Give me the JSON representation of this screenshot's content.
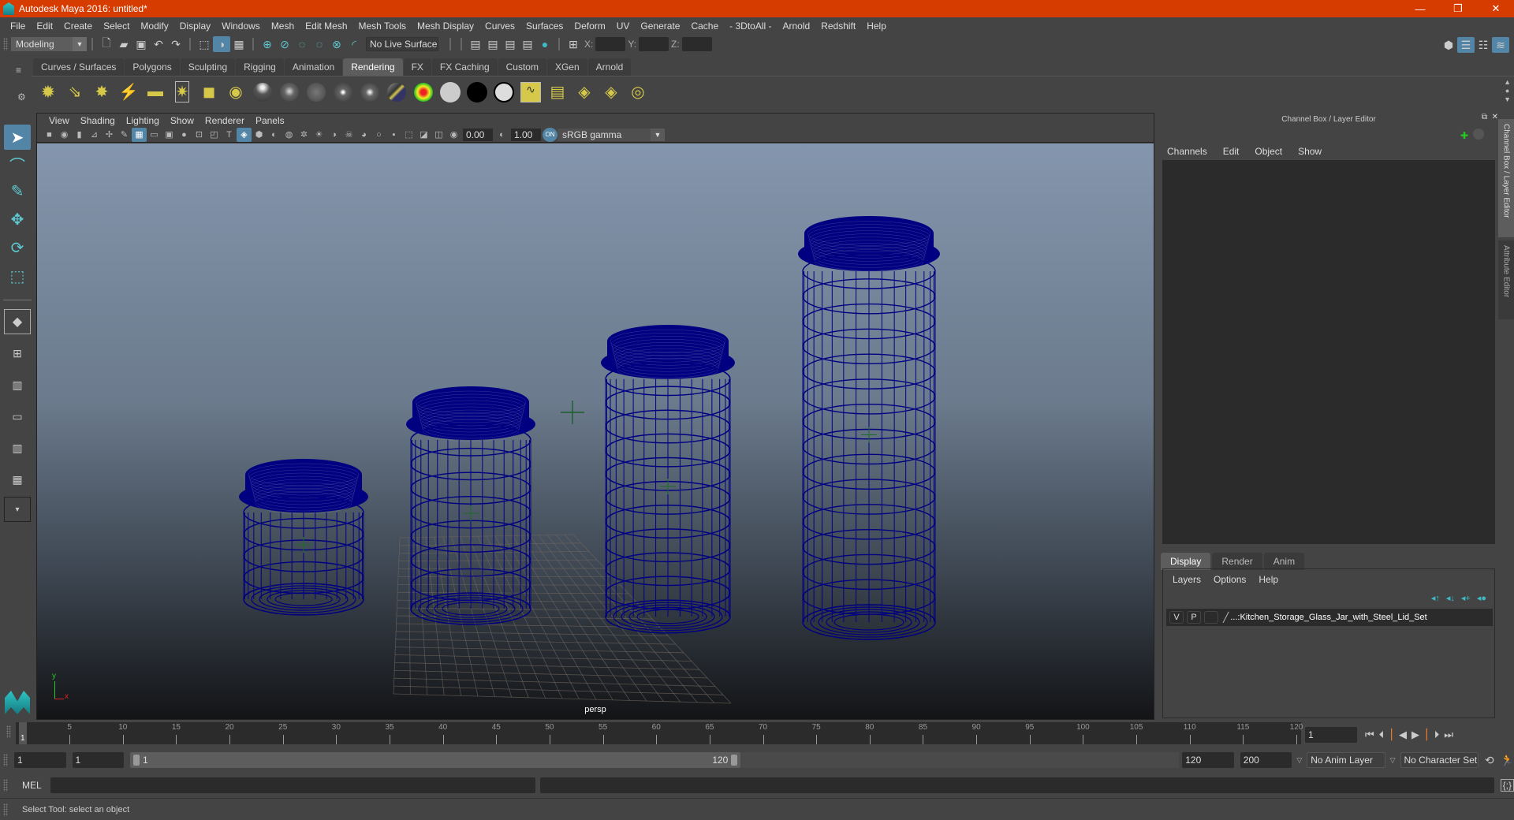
{
  "titlebar": {
    "title": "Autodesk Maya 2016: untitled*",
    "minimize": "—",
    "restore": "❐",
    "close": "✕"
  },
  "menubar": [
    "File",
    "Edit",
    "Create",
    "Select",
    "Modify",
    "Display",
    "Windows",
    "Mesh",
    "Edit Mesh",
    "Mesh Tools",
    "Mesh Display",
    "Curves",
    "Surfaces",
    "Deform",
    "UV",
    "Generate",
    "Cache",
    "- 3DtoAll -",
    "Arnold",
    "Redshift",
    "Help"
  ],
  "statusline": {
    "menuset": "Modeling",
    "live_surface": "No Live Surface",
    "x_label": "X:",
    "y_label": "Y:",
    "z_label": "Z:",
    "x_value": "",
    "y_value": "",
    "z_value": ""
  },
  "shelf": {
    "tabs": [
      "Curves / Surfaces",
      "Polygons",
      "Sculpting",
      "Rigging",
      "Animation",
      "Rendering",
      "FX",
      "FX Caching",
      "Custom",
      "XGen",
      "Arnold"
    ],
    "active_tab": "Rendering"
  },
  "viewport": {
    "menu": [
      "View",
      "Shading",
      "Lighting",
      "Show",
      "Renderer",
      "Panels"
    ],
    "exposure": "0.00",
    "gamma": "1.00",
    "color_space": "sRGB gamma",
    "camera_label": "persp",
    "axis_y": "y",
    "axis_x": "x"
  },
  "channel_box": {
    "title": "Channel Box / Layer Editor",
    "menu": [
      "Channels",
      "Edit",
      "Object",
      "Show"
    ]
  },
  "layer_editor": {
    "tabs": [
      "Display",
      "Render",
      "Anim"
    ],
    "active_tab": "Display",
    "menu": [
      "Layers",
      "Options",
      "Help"
    ],
    "layers": [
      {
        "v": "V",
        "p": "P",
        "name": "...:Kitchen_Storage_Glass_Jar_with_Steel_Lid_Set"
      }
    ]
  },
  "side_tabs": [
    "Channel Box / Layer Editor",
    "Attribute Editor"
  ],
  "timeline": {
    "ticks": [
      5,
      10,
      15,
      20,
      25,
      30,
      35,
      40,
      45,
      50,
      55,
      60,
      65,
      70,
      75,
      80,
      85,
      90,
      95,
      100,
      105,
      110,
      115,
      120
    ],
    "start": 1,
    "end": 120,
    "current_frame_label": "1",
    "current_frame": "1"
  },
  "range": {
    "start_field": "1",
    "playback_start": "1",
    "slider_start": "1",
    "slider_end": "120",
    "playback_end": "120",
    "end_field": "200",
    "anim_layer": "No Anim Layer",
    "character_set": "No Character Set"
  },
  "command_line": {
    "label": "MEL",
    "value": ""
  },
  "help_line": "Select Tool: select an object",
  "colors": {
    "title_bar": "#d63c00",
    "wireframe": "#000080",
    "selection": "#5285a6",
    "accent_teal": "#3dbcc6"
  }
}
